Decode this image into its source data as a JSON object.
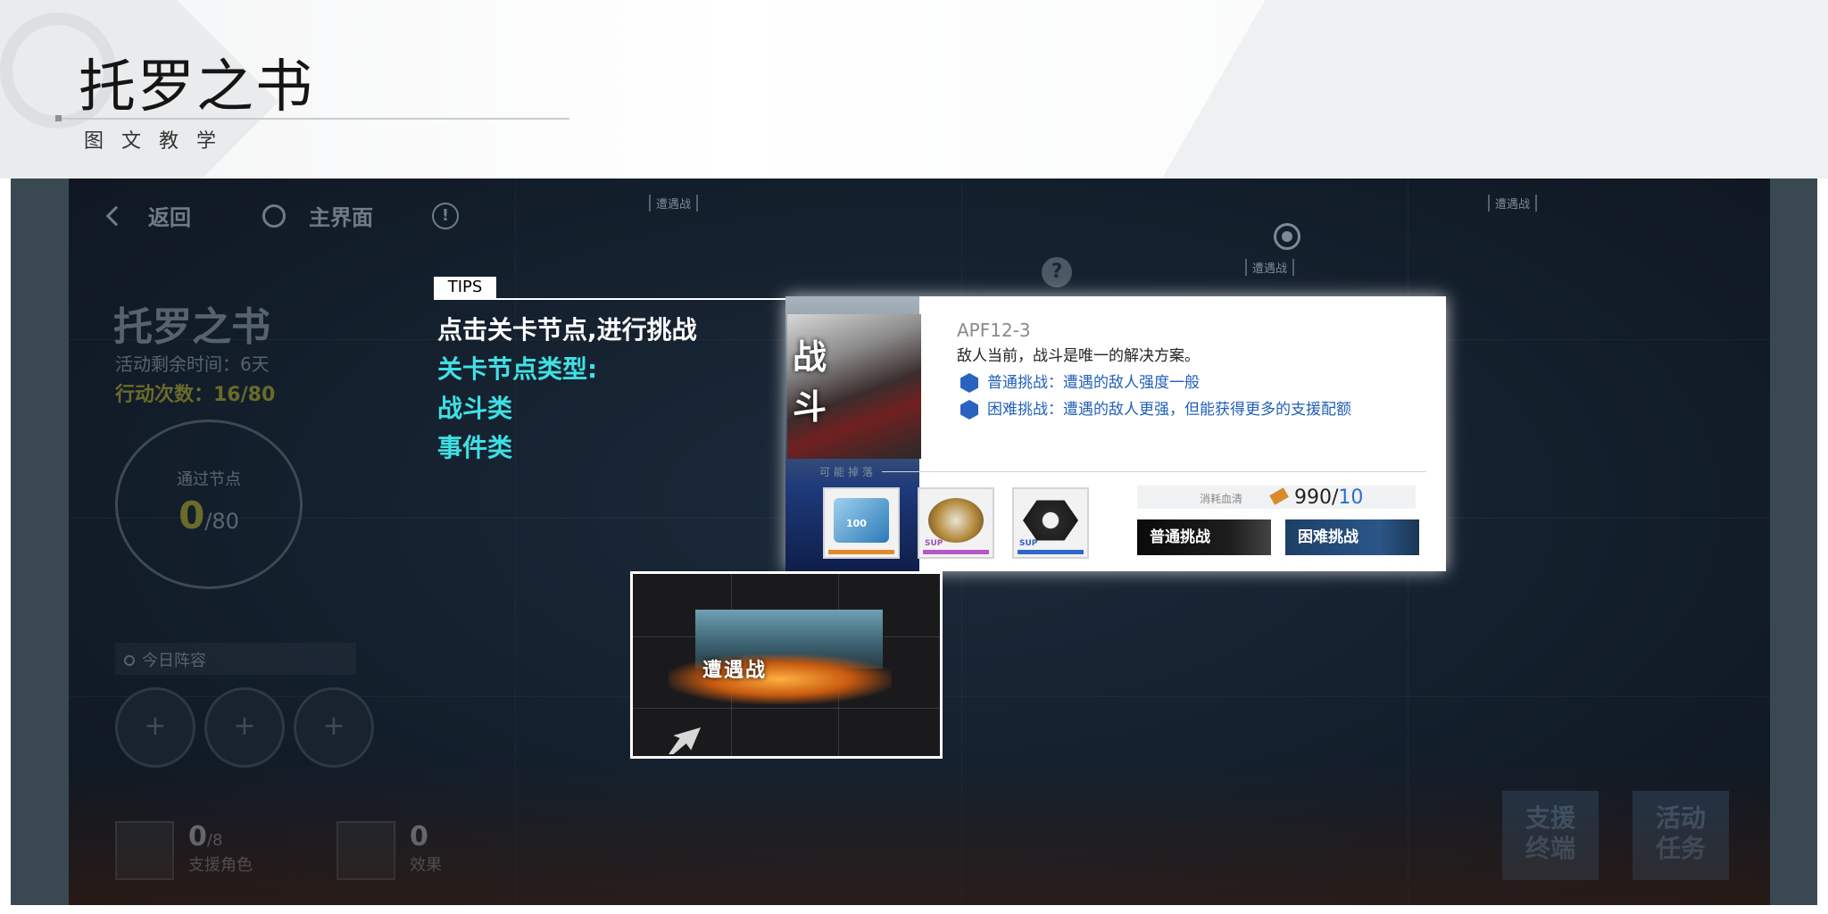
{
  "banner": {
    "title": "托罗之书",
    "subtitle": "图文教学"
  },
  "game": {
    "nav": {
      "back_label": "返回",
      "home_label": "主界面",
      "info_glyph": "!"
    },
    "event": {
      "title": "托罗之书",
      "time_remaining": "活动剩余时间：6天",
      "action_count": "行动次数：16/80"
    },
    "progress": {
      "label": "通过节点",
      "passed": "0",
      "total": "/80"
    },
    "lineup": {
      "search_label": "今日阵容",
      "slot_glyph": "+"
    },
    "support": {
      "count": "0",
      "total": "/8",
      "label": "支援角色"
    },
    "effect": {
      "count": "0",
      "label": "效果"
    },
    "side_buttons": [
      {
        "label_line1": "支援",
        "label_line2": "终端"
      },
      {
        "label_line1": "活动",
        "label_line2": "任务"
      }
    ],
    "map_labels": [
      "遭遇战",
      "遭遇战",
      "遭遇战"
    ],
    "unknown_node_glyph": "?"
  },
  "tips": {
    "tag": "TIPS",
    "lines": [
      "点击关卡节点,进行挑战",
      "关卡节点类型:",
      "战斗类",
      "事件类"
    ]
  },
  "stage_card": {
    "type_label": "战斗",
    "code": "APF12-3",
    "description": "敌人当前，战斗是唯一的解决方案。",
    "options": [
      "普通挑战：遭遇的敌人强度一般",
      "困难挑战：遭遇的敌人更强，但能获得更多的支援配额"
    ],
    "drops_label": "可能掉落",
    "cost_label": "消耗血清",
    "cost_have": "990/",
    "cost_need": "10",
    "normal_button": "普通挑战",
    "hard_button": "困难挑战",
    "item_badge_1": "100",
    "item_badge_2": "SUP",
    "item_badge_3": "SUP"
  },
  "preview": {
    "label": "遭遇战"
  },
  "colors": {
    "tips_cyan": "#3fe0e4",
    "option_blue": "#2260b8",
    "hard_button": "#1d3f66",
    "normal_button": "#111111",
    "accent_olive": "#6a6b2a"
  },
  "icons": [
    "back-chevron-icon",
    "home-circle-icon",
    "info-icon",
    "search-icon",
    "plus-icon",
    "support-icon",
    "effect-icon",
    "hexagon-icon",
    "serum-key-icon",
    "cursor-arrow-icon"
  ]
}
